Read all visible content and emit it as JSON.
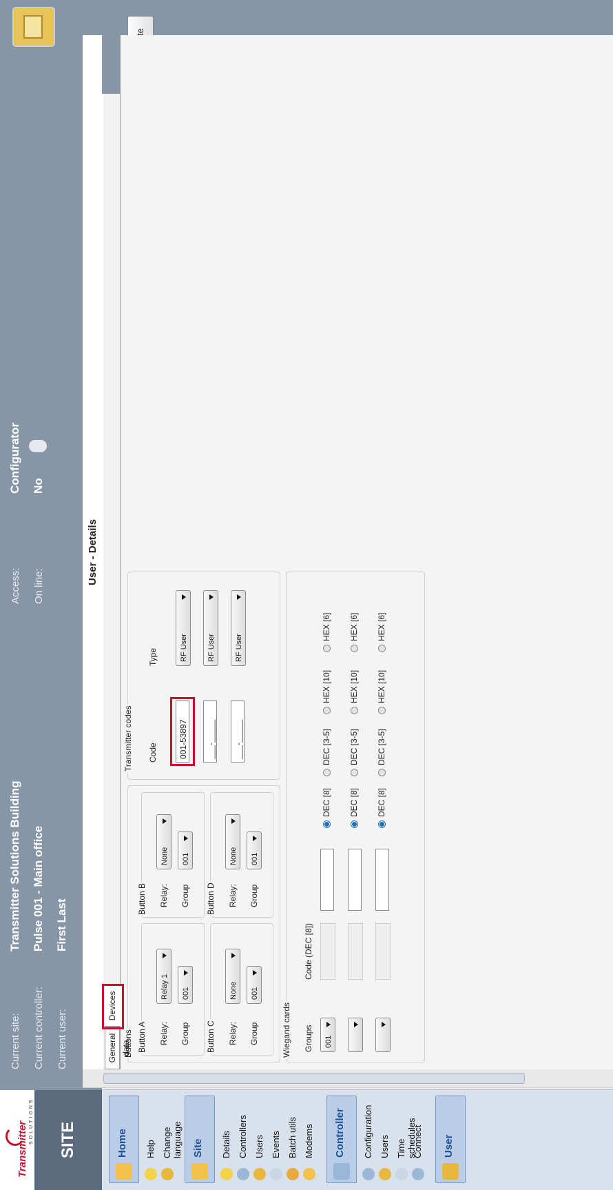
{
  "app": {
    "brand_word": "Transmitter",
    "brand_sub": "SOLUTIONS",
    "title": "SITE MANAGER"
  },
  "header": {
    "current_site_label": "Current site:",
    "current_site": "Transmitter Solutions Building",
    "current_controller_label": "Current controller:",
    "current_controller": "Pulse 001 - Main office",
    "current_user_label": "Current user:",
    "current_user": "First Last",
    "access_label": "Access:",
    "access_value": "Configurator",
    "online_label": "On line:",
    "online_value": "No"
  },
  "sidebar": {
    "home": {
      "label": "Home",
      "items": [
        {
          "label": "Help",
          "icon": "help-icon"
        },
        {
          "label": "Change language",
          "icon": "language-icon"
        }
      ]
    },
    "site": {
      "label": "Site",
      "items": [
        {
          "label": "Details",
          "icon": "details-icon"
        },
        {
          "label": "Controllers",
          "icon": "controllers-icon"
        },
        {
          "label": "Users",
          "icon": "users-icon"
        },
        {
          "label": "Events",
          "icon": "events-icon"
        },
        {
          "label": "Batch utils",
          "icon": "batch-icon"
        },
        {
          "label": "Modems",
          "icon": "modems-icon"
        }
      ]
    },
    "controller": {
      "label": "Controller",
      "items": [
        {
          "label": "Configuration",
          "icon": "configuration-icon"
        },
        {
          "label": "Users",
          "icon": "users-icon"
        },
        {
          "label": "Time schedules",
          "icon": "schedule-icon"
        },
        {
          "label": "Connect",
          "icon": "connect-icon"
        }
      ]
    },
    "user": {
      "label": "User"
    }
  },
  "content": {
    "title": "User - Details",
    "tabs": {
      "general": "General data",
      "devices": "Devices"
    },
    "buttons": {
      "caption": "Buttons",
      "a": {
        "title": "Button A",
        "relay_label": "Relay:",
        "relay": "Relay 1",
        "group_label": "Group",
        "group": "001"
      },
      "b": {
        "title": "Button B",
        "relay_label": "Relay:",
        "relay": "None",
        "group_label": "Group",
        "group": "001"
      },
      "c": {
        "title": "Button C",
        "relay_label": "Relay:",
        "relay": "None",
        "group_label": "Group",
        "group": "001"
      },
      "d": {
        "title": "Button D",
        "relay_label": "Relay:",
        "relay": "None",
        "group_label": "Group",
        "group": "001"
      }
    },
    "transmitter": {
      "caption": "Transmitter codes",
      "code_label": "Code",
      "type_label": "Type",
      "rows": [
        {
          "code": "001-53897",
          "type": "RF User"
        },
        {
          "code": "___-_____",
          "type": "RF User"
        },
        {
          "code": "___-_____",
          "type": "RF User"
        }
      ]
    },
    "wiegand": {
      "caption": "Wiegand cards",
      "groups_label": "Groups",
      "code_label": "Code (DEC [8])",
      "rows": [
        {
          "group": "001"
        },
        {
          "group": ""
        },
        {
          "group": ""
        }
      ],
      "options": [
        "DEC [8]",
        "DEC [3-5]",
        "HEX [10]",
        "HEX [6]"
      ]
    },
    "update_label": "Update"
  }
}
